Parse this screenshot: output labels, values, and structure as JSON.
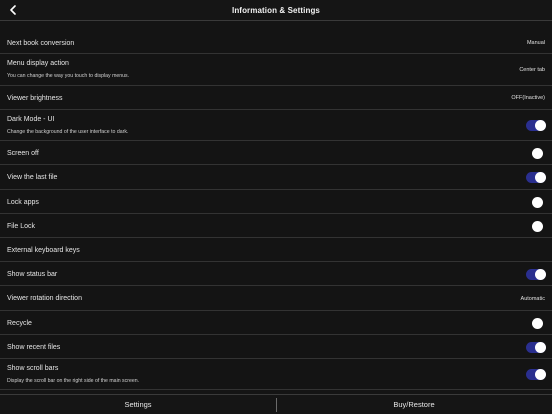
{
  "header": {
    "title": "Information & Settings",
    "back_icon": "chevron-left-icon"
  },
  "settings": {
    "next_book_conversion": {
      "label": "Next book conversion",
      "value": "Manual"
    },
    "menu_display_action": {
      "label": "Menu display action",
      "desc": "You can change the way you touch to display menus.",
      "value": "Center tab"
    },
    "viewer_brightness": {
      "label": "Viewer brightness",
      "value": "OFF(Inactive)"
    },
    "dark_mode_ui": {
      "label": "Dark Mode - UI",
      "desc": "Change the background of the user interface to dark.",
      "enabled": true
    },
    "screen_off": {
      "label": "Screen off",
      "enabled": false
    },
    "view_last_file": {
      "label": "View the last file",
      "enabled": true
    },
    "lock_apps": {
      "label": "Lock apps",
      "enabled": false
    },
    "file_lock": {
      "label": "File Lock",
      "enabled": false
    },
    "external_keyboard_keys": {
      "label": "External keyboard keys"
    },
    "show_status_bar": {
      "label": "Show status bar",
      "enabled": true
    },
    "viewer_rotation_direction": {
      "label": "Viewer rotation direction",
      "value": "Automatic"
    },
    "recycle": {
      "label": "Recycle",
      "enabled": false
    },
    "show_recent_files": {
      "label": "Show recent files",
      "enabled": true
    },
    "show_scroll_bars": {
      "label": "Show scroll bars",
      "desc": "Display the scroll bar on the right side of the main screen.",
      "enabled": true
    }
  },
  "colors": {
    "toggle_on": "#2a2f8f",
    "background": "#141414"
  },
  "footer": {
    "settings_label": "Settings",
    "buy_restore_label": "Buy/Restore"
  }
}
